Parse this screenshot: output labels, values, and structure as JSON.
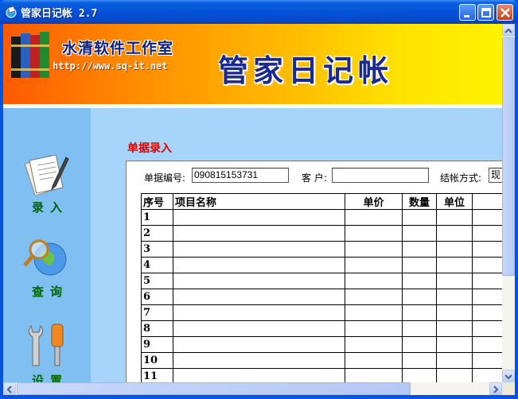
{
  "window": {
    "title": "管家日记帐 2.7",
    "minimize_label": "Minimize",
    "maximize_label": "Maximize",
    "close_label": "Close"
  },
  "banner": {
    "studio_name": "水清软件工作室",
    "url": "http://www.sq-it.net",
    "app_title": "管家日记帐"
  },
  "sidebar": {
    "items": [
      {
        "label": "录入",
        "icon": "document-pen-icon"
      },
      {
        "label": "查询",
        "icon": "magnifier-globe-icon"
      },
      {
        "label": "设置",
        "icon": "tools-icon"
      }
    ]
  },
  "form": {
    "section_title": "单据录入",
    "doc_no_label": "单据编号:",
    "doc_no_value": "090815153731",
    "customer_label": "客 户:",
    "customer_value": "",
    "payment_label": "结帐方式:",
    "payment_value": "现"
  },
  "table": {
    "headers": [
      "序号",
      "项目名称",
      "单价",
      "数量",
      "单位",
      ""
    ],
    "rows": [
      "1",
      "2",
      "3",
      "4",
      "5",
      "6",
      "7",
      "8",
      "9",
      "10",
      "11"
    ]
  },
  "colors": {
    "title_blue": "#0054e3",
    "section_title_red": "#e00000",
    "nav_label_green": "#006400",
    "sidebar_bg": "#7fbff2",
    "main_bg": "#a6d4fb"
  }
}
